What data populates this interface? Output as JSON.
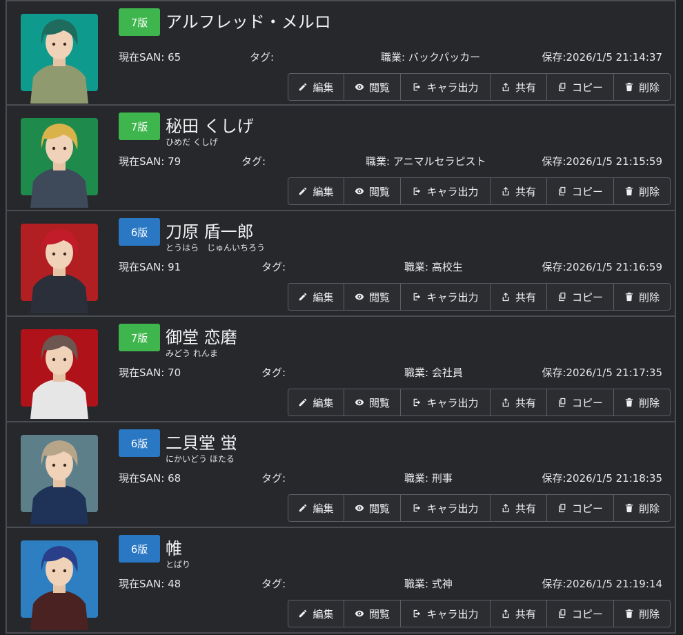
{
  "buttons": {
    "edit": "編集",
    "view": "閲覧",
    "export": "キャラ出力",
    "share": "共有",
    "copy": "コピー",
    "delete": "削除"
  },
  "icons": [
    "pencil-icon",
    "eye-icon",
    "export-icon",
    "share-icon",
    "copy-icon",
    "trash-icon"
  ],
  "characters": [
    {
      "edition": "7版",
      "edition_color": "#3fb64d",
      "name": "アルフレッド・メルロ",
      "kana": "",
      "san": "現在SAN: 65",
      "tag": "タグ:",
      "job": "職業: バックパッカー",
      "saved": "保存:2026/1/5 21:14:37",
      "portrait_bg": "#0f9a8e",
      "hair": "#1f6b5e",
      "outfit": "#8f9a6f"
    },
    {
      "edition": "7版",
      "edition_color": "#3fb64d",
      "name": "秘田 くしげ",
      "kana": "ひめだ くしげ",
      "san": "現在SAN: 79",
      "tag": "タグ:",
      "job": "職業: アニマルセラピスト",
      "saved": "保存:2026/1/5 21:15:59",
      "portrait_bg": "#1e8a4c",
      "hair": "#d9b24a",
      "outfit": "#3e4a5a"
    },
    {
      "edition": "6版",
      "edition_color": "#2a78c4",
      "name": "刀原 盾一郎",
      "kana": "とうはら　じゅんいちろう",
      "san": "現在SAN: 91",
      "tag": "タグ:",
      "job": "職業: 高校生",
      "saved": "保存:2026/1/5 21:16:59",
      "portrait_bg": "#b11f22",
      "hair": "#c21c2a",
      "outfit": "#2b2f3a"
    },
    {
      "edition": "7版",
      "edition_color": "#3fb64d",
      "name": "御堂 恋磨",
      "kana": "みどう れんま",
      "san": "現在SAN: 70",
      "tag": "タグ:",
      "job": "職業: 会社員",
      "saved": "保存:2026/1/5 21:17:35",
      "portrait_bg": "#b0121a",
      "hair": "#6e5650",
      "outfit": "#e6e6e6"
    },
    {
      "edition": "6版",
      "edition_color": "#2a78c4",
      "name": "二貝堂 蛍",
      "kana": "にかいどう ほたる",
      "san": "現在SAN: 68",
      "tag": "タグ:",
      "job": "職業: 刑事",
      "saved": "保存:2026/1/5 21:18:35",
      "portrait_bg": "#5c7f8a",
      "hair": "#b7a58a",
      "outfit": "#1e3357"
    },
    {
      "edition": "6版",
      "edition_color": "#2a78c4",
      "name": "帷",
      "kana": "とばり",
      "san": "現在SAN: 48",
      "tag": "タグ:",
      "job": "職業: 式神",
      "saved": "保存:2026/1/5 21:19:14",
      "portrait_bg": "#2d7fc1",
      "hair": "#2a3f8a",
      "outfit": "#4a2222"
    }
  ]
}
